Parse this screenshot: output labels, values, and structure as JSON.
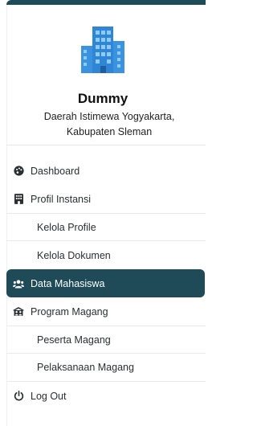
{
  "brand": {
    "name": "Dummy",
    "region_line1": "Daerah Istimewa Yogyakarta,",
    "region_line2": "Kabupaten Sleman"
  },
  "colors": {
    "primary": "#1e4b57",
    "logo_blue": "#2f86d6",
    "logo_light": "#7fc0f0"
  },
  "menu": {
    "dashboard": {
      "label": "Dashboard",
      "icon": "palette-icon"
    },
    "profil_instansi": {
      "label": "Profil Instansi",
      "icon": "building-icon"
    },
    "kelola_profile": {
      "label": "Kelola Profile"
    },
    "kelola_dokumen": {
      "label": "Kelola Dokumen"
    },
    "data_mahasiswa": {
      "label": "Data Mahasiswa",
      "icon": "users-icon",
      "active": true
    },
    "program_magang": {
      "label": "Program Magang",
      "icon": "people-roof-icon"
    },
    "peserta_magang": {
      "label": "Peserta Magang"
    },
    "pelaksanaan_magang": {
      "label": "Pelaksanaan Magang"
    },
    "logout": {
      "label": "Log Out",
      "icon": "power-icon"
    }
  }
}
